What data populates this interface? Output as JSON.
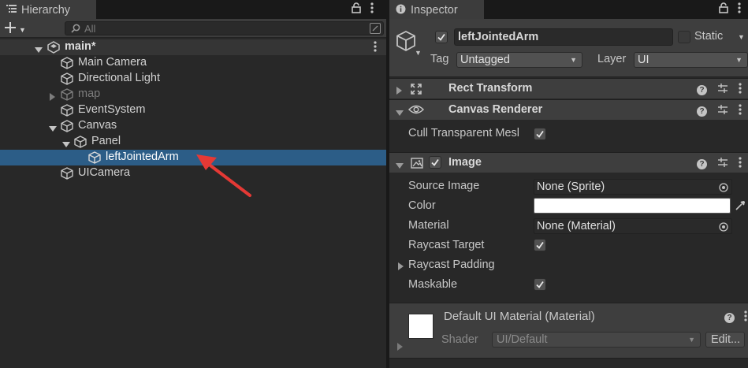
{
  "hierarchy": {
    "tab_label": "Hierarchy",
    "search_placeholder": "All",
    "scene": {
      "name": "main*"
    },
    "items": [
      {
        "label": "Main Camera"
      },
      {
        "label": "Directional Light"
      },
      {
        "label": "map"
      },
      {
        "label": "EventSystem"
      },
      {
        "label": "Canvas"
      },
      {
        "label": "Panel"
      },
      {
        "label": "leftJointedArm"
      },
      {
        "label": "UICamera"
      }
    ]
  },
  "inspector": {
    "tab_label": "Inspector",
    "object_name": "leftJointedArm",
    "static_label": "Static",
    "tag_label": "Tag",
    "tag_value": "Untagged",
    "layer_label": "Layer",
    "layer_value": "UI",
    "components": {
      "rect_transform": "Rect Transform",
      "canvas_renderer": "Canvas Renderer",
      "image": "Image"
    },
    "canvas_renderer_props": {
      "cull_label": "Cull Transparent Mesl"
    },
    "image_props": {
      "source_image_label": "Source Image",
      "source_image_value": "None (Sprite)",
      "color_label": "Color",
      "material_label": "Material",
      "material_value": "None (Material)",
      "raycast_target_label": "Raycast Target",
      "raycast_padding_label": "Raycast Padding",
      "maskable_label": "Maskable"
    },
    "material_preview": {
      "name": "Default UI Material (Material)",
      "shader_label": "Shader",
      "shader_value": "UI/Default",
      "edit_label": "Edit..."
    }
  },
  "colors": {
    "selection": "#2c5d87",
    "annotation_arrow": "#e53935"
  }
}
